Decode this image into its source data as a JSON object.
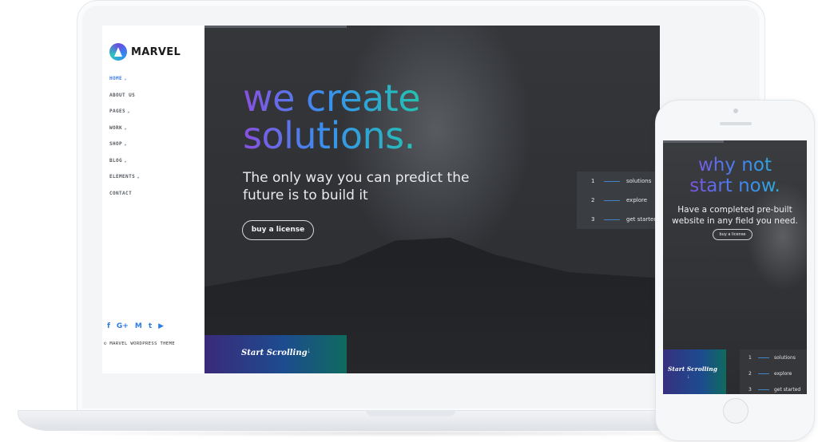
{
  "brand": {
    "name": "MARVEL",
    "logo_icon": "marvel-logo-icon"
  },
  "sidebar": {
    "nav": [
      {
        "label": "HOME",
        "has_dropdown": true,
        "active": true
      },
      {
        "label": "ABOUT US",
        "has_dropdown": false
      },
      {
        "label": "PAGES",
        "has_dropdown": true
      },
      {
        "label": "WORK",
        "has_dropdown": true
      },
      {
        "label": "SHOP",
        "has_dropdown": true
      },
      {
        "label": "BLOG",
        "has_dropdown": true
      },
      {
        "label": "ELEMENTS",
        "has_dropdown": true
      },
      {
        "label": "CONTACT",
        "has_dropdown": false
      }
    ],
    "socials": [
      {
        "icon": "facebook-icon",
        "glyph": "f"
      },
      {
        "icon": "google-plus-icon",
        "glyph": "G+"
      },
      {
        "icon": "medium-icon",
        "glyph": "M"
      },
      {
        "icon": "twitter-icon",
        "glyph": "t"
      },
      {
        "icon": "youtube-icon",
        "glyph": "▶"
      }
    ],
    "copyright": "© MARVEL WORDPRESS THEME"
  },
  "hero": {
    "headline_line1": "we create",
    "headline_line2": "solutions.",
    "subline": "The only way you can predict the future is to build it",
    "button_label": "buy a license",
    "scroll_label": "Start Scrolling",
    "steps": [
      {
        "num": "1",
        "label": "solutions"
      },
      {
        "num": "2",
        "label": "explore"
      },
      {
        "num": "3",
        "label": "get started"
      }
    ]
  },
  "phone": {
    "headline_line1": "why not",
    "headline_line2": "start now.",
    "subline": "Have a completed pre-built website in any field you need.",
    "button_label": "buy a license",
    "scroll_label": "Start Scrolling",
    "steps": [
      {
        "num": "1",
        "label": "solutions"
      },
      {
        "num": "2",
        "label": "explore"
      },
      {
        "num": "3",
        "label": "get started"
      }
    ]
  },
  "colors": {
    "accent_blue": "#3f7de8",
    "gradient_purple": "#8a4fe0",
    "gradient_teal": "#22c3b0",
    "hero_bg": "#2d2f33"
  }
}
